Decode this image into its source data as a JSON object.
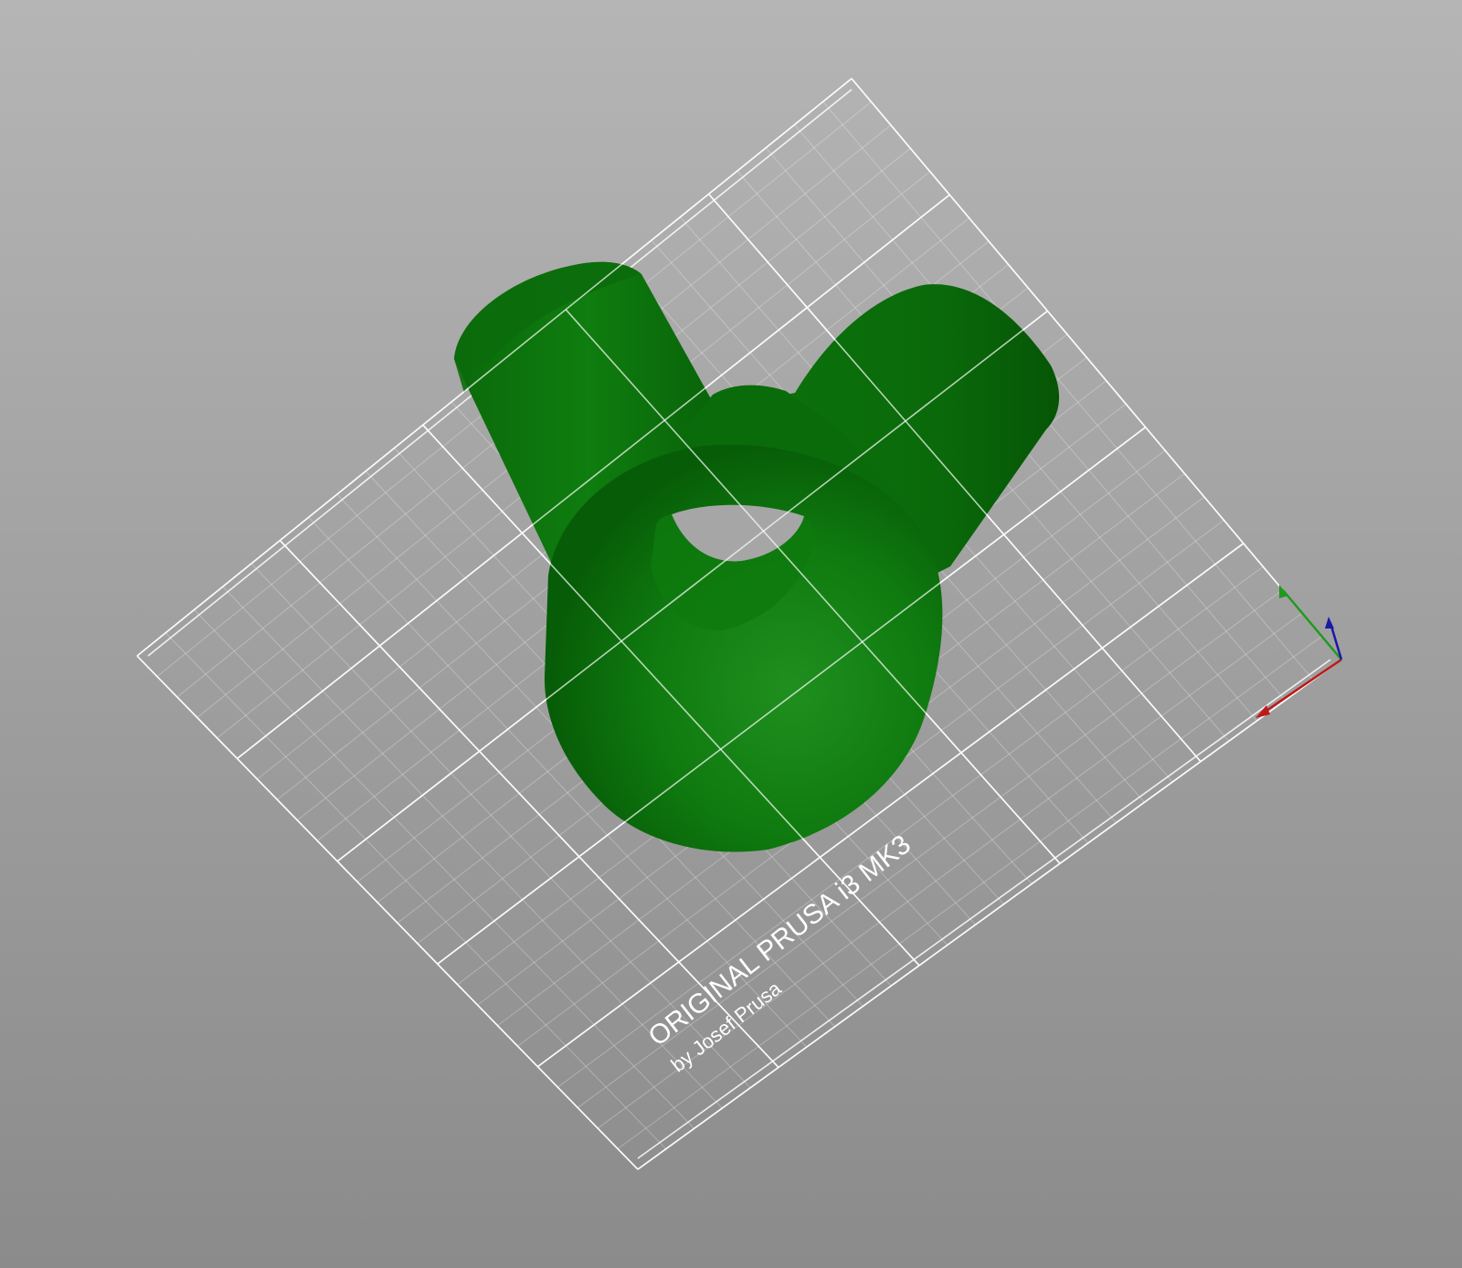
{
  "scene": {
    "background_top": "#b5b5b5",
    "background_bottom": "#8b8b8b",
    "model_color": "#0c7a0c",
    "grid_color": "#ffffff"
  },
  "bed": {
    "logo_title": "ORIGINAL PRUSA i3 MK3",
    "logo_subtitle": "by Josef Prusa"
  },
  "axes": {
    "x_color": "#c01818",
    "y_color": "#1e9a1e",
    "z_color": "#1a1aa8"
  }
}
